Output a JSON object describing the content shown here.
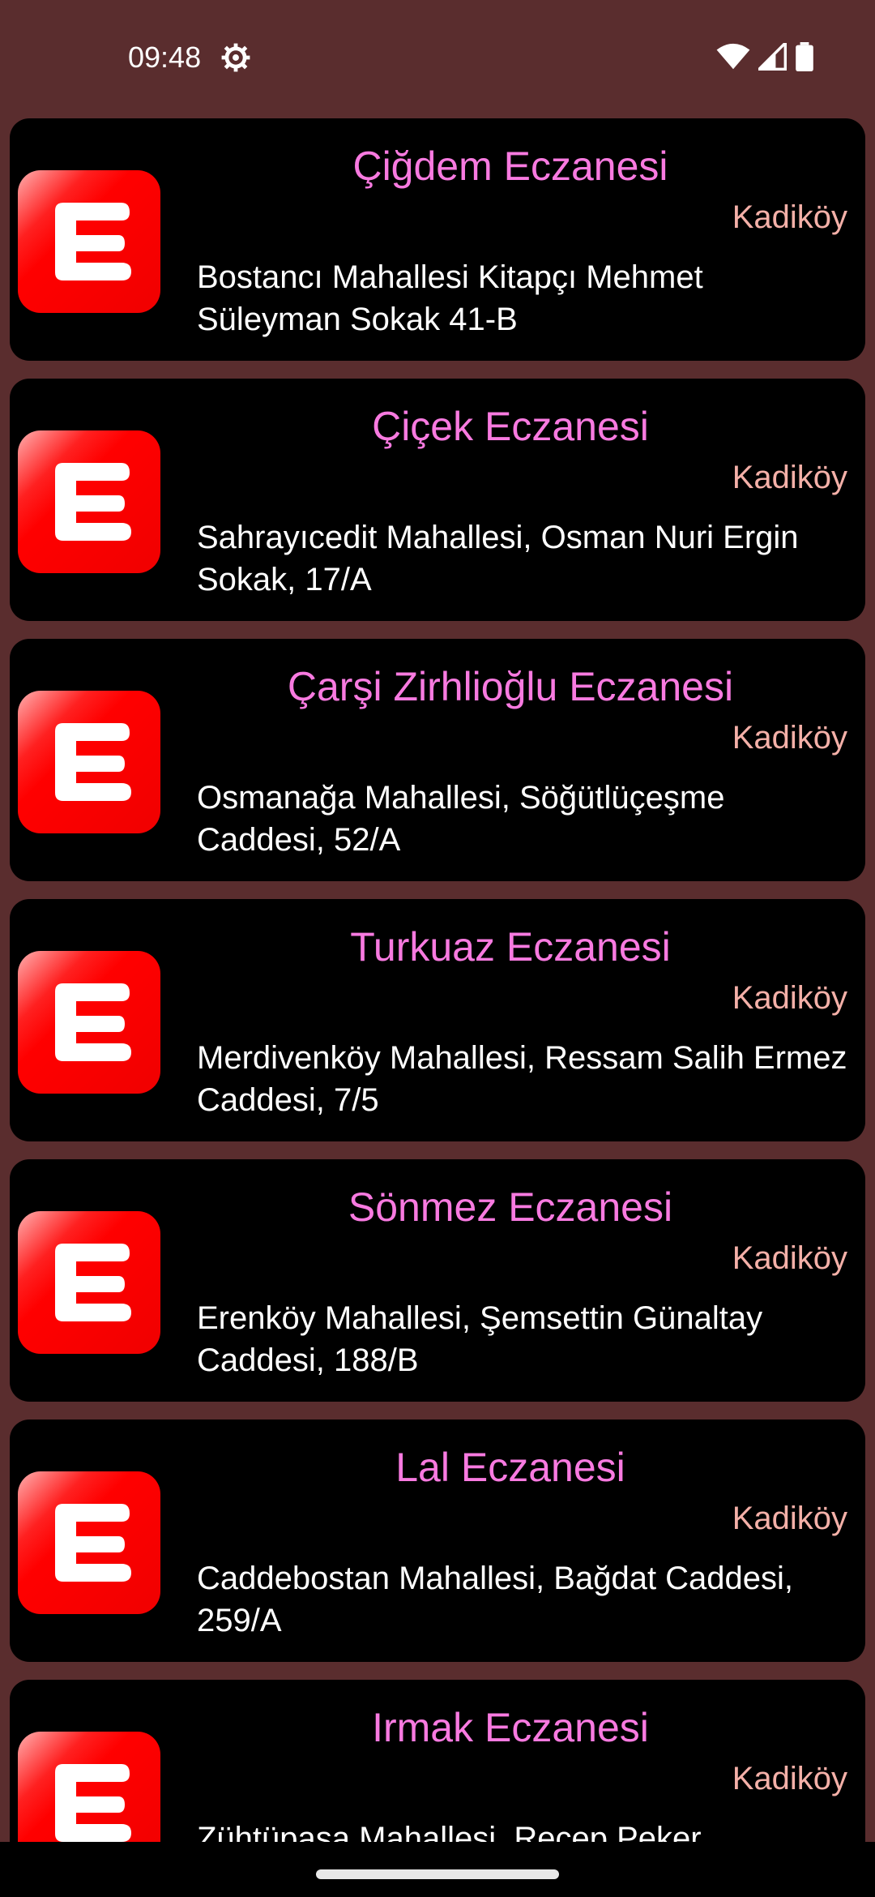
{
  "status_bar": {
    "time": "09:48",
    "icons": [
      "gear-icon",
      "wifi-icon",
      "cell-signal-icon",
      "battery-icon"
    ]
  },
  "colors": {
    "background": "#5a2d2e",
    "card": "#000000",
    "title": "#f87ae0",
    "district": "#f4b0a8",
    "icon_red": "#ff0000"
  },
  "pharmacies": [
    {
      "name": "Çiğdem Eczanesi",
      "district": "Kadiköy",
      "address": "Bostancı Mahallesi Kitapçı Mehmet Süleyman Sokak 41-B"
    },
    {
      "name": "Çiçek Eczanesi",
      "district": "Kadiköy",
      "address": "Sahrayıcedit Mahallesi, Osman Nuri Ergin Sokak, 17/A"
    },
    {
      "name": "Çarşi Zirhlioğlu Eczanesi",
      "district": "Kadiköy",
      "address": "Osmanağa Mahallesi, Söğütlüçeşme Caddesi, 52/A"
    },
    {
      "name": "Turkuaz Eczanesi",
      "district": "Kadiköy",
      "address": "Merdivenköy Mahallesi, Ressam Salih Ermez Caddesi, 7/5"
    },
    {
      "name": "Sönmez Eczanesi",
      "district": "Kadiköy",
      "address": "Erenköy Mahallesi, Şemsettin Günaltay Caddesi, 188/B"
    },
    {
      "name": "Lal Eczanesi",
      "district": "Kadiköy",
      "address": "Caddebostan Mahallesi, Bağdat Caddesi, 259/A"
    },
    {
      "name": "Irmak Eczanesi",
      "district": "Kadiköy",
      "address": "Zühtüpaşa Mahallesi, Recep Peker"
    }
  ]
}
